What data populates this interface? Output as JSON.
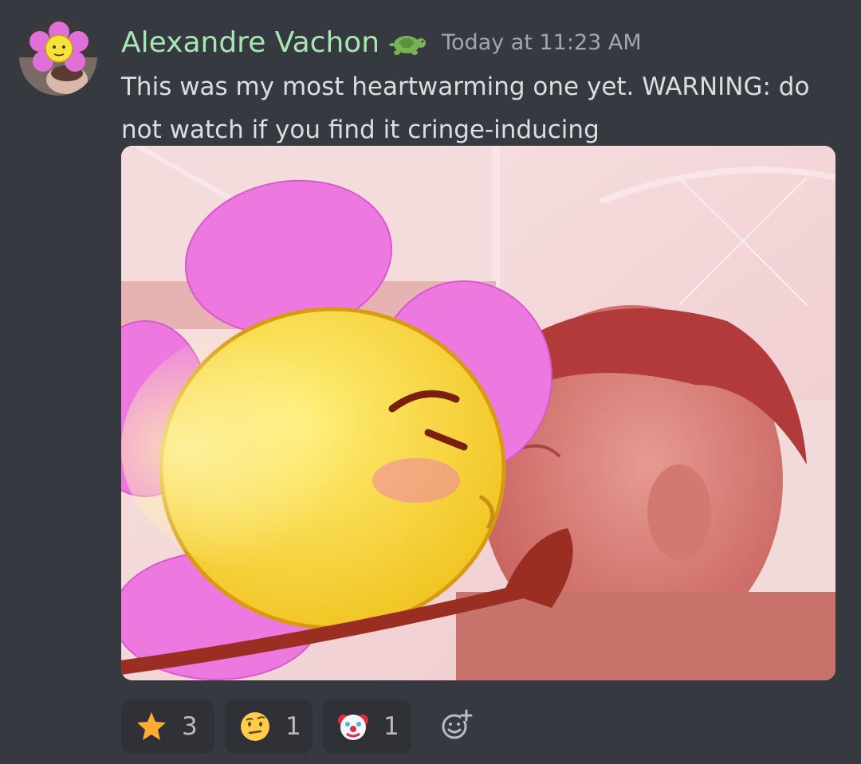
{
  "message": {
    "author": "Alexandre Vachon",
    "author_color": "#a8e6b4",
    "author_badge": "turtle-icon",
    "timestamp": "Today at 11:23 AM",
    "text": "This was my most heartwarming one yet. WARNING: do not watch if you find it cringe-inducing",
    "attachment": "image-attachment"
  },
  "reactions": [
    {
      "emoji": "star-icon",
      "count": "3"
    },
    {
      "emoji": "face-with-raised-eyebrow-icon",
      "count": "1"
    },
    {
      "emoji": "clown-face-icon",
      "count": "1"
    }
  ],
  "add_reaction": "add-reaction-icon",
  "colors": {
    "background": "#36393f",
    "reaction_bg": "#2f3136",
    "text": "#dcddde",
    "muted": "#a3a6aa"
  }
}
